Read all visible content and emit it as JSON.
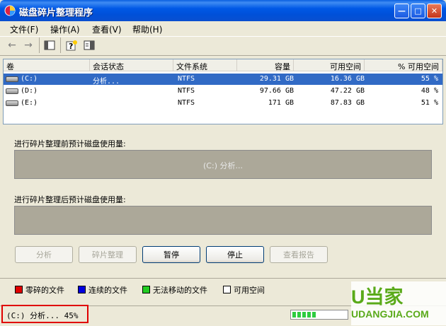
{
  "window": {
    "title": "磁盘碎片整理程序",
    "minimize_glyph": "—",
    "maximize_glyph": "□",
    "close_glyph": "✕"
  },
  "menu": [
    {
      "label": "文件(F)"
    },
    {
      "label": "操作(A)"
    },
    {
      "label": "查看(V)"
    },
    {
      "label": "帮助(H)"
    }
  ],
  "toolbar": {
    "icons": [
      "back-arrow-icon",
      "forward-arrow-icon",
      "console-tree-icon",
      "help-icon",
      "properties-icon"
    ]
  },
  "table": {
    "columns": [
      "卷",
      "会话状态",
      "文件系统",
      "容量",
      "可用空间",
      "% 可用空间"
    ],
    "rows": [
      {
        "volume": "(C:)",
        "status": "分析...",
        "fs": "NTFS",
        "capacity": "29.31 GB",
        "free": "16.36 GB",
        "pct": "55 %",
        "selected": true
      },
      {
        "volume": "(D:)",
        "status": "",
        "fs": "NTFS",
        "capacity": "97.66 GB",
        "free": "47.22 GB",
        "pct": "48 %",
        "selected": false
      },
      {
        "volume": "(E:)",
        "status": "",
        "fs": "NTFS",
        "capacity": "171 GB",
        "free": "87.83 GB",
        "pct": "51 %",
        "selected": false
      }
    ]
  },
  "analysis": {
    "before_label": "进行碎片整理前预计磁盘使用量:",
    "before_status": "(C:) 分析...",
    "after_label": "进行碎片整理后预计磁盘使用量:"
  },
  "buttons": {
    "analyze": "分析",
    "defrag": "碎片整理",
    "pause": "暂停",
    "stop": "停止",
    "report": "查看报告"
  },
  "legend": [
    {
      "label": "零碎的文件",
      "color": "#e00000"
    },
    {
      "label": "连续的文件",
      "color": "#0000e0"
    },
    {
      "label": "无法移动的文件",
      "color": "#22cc22"
    },
    {
      "label": "可用空间",
      "color": "#ffffff"
    }
  ],
  "status": {
    "text": "(C:) 分析... 45%",
    "progress": 0.45
  },
  "watermark": {
    "logo": "U当家",
    "url": "UDANGJIA.COM"
  }
}
